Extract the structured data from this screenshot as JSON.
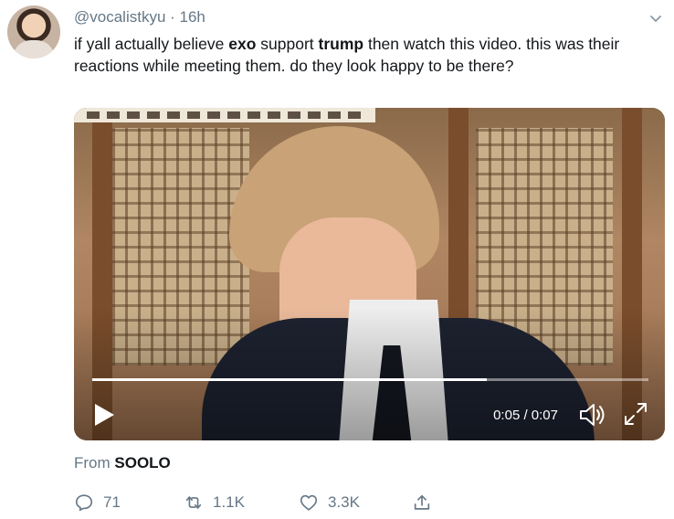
{
  "tweet": {
    "handle": "@vocalistkyu",
    "separator": " · ",
    "time": "16h",
    "text_parts": [
      "if yall actually believe ",
      "exo",
      " support ",
      "trump",
      " then watch this video. this was their reactions while meeting them. do they look happy to be there?"
    ]
  },
  "video": {
    "progress_fraction": 0.71,
    "time_display": "0:05 / 0:07",
    "controls": [
      "play-icon",
      "volume-icon",
      "fullscreen-icon"
    ]
  },
  "source": {
    "prefix": "From ",
    "name": "SOOLO"
  },
  "actions": {
    "reply_count": "71",
    "retweet_count": "1.1K",
    "like_count": "3.3K"
  },
  "colors": {
    "text": "#14171a",
    "muted": "#657786",
    "background": "#ffffff"
  }
}
